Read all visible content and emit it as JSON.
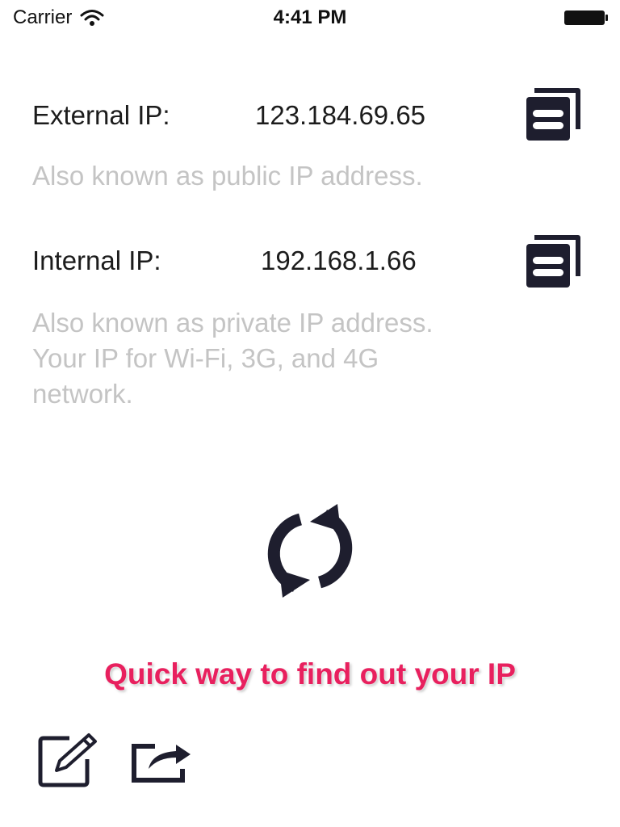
{
  "status_bar": {
    "carrier": "Carrier",
    "time": "4:41 PM",
    "wifi_icon": "wifi-icon",
    "battery_icon": "battery-icon"
  },
  "external": {
    "label": "External IP:",
    "value": "123.184.69.65",
    "description": "Also known as public IP address.",
    "copy_icon": "copy-icon"
  },
  "internal": {
    "label": "Internal IP:",
    "value": "192.168.1.66",
    "description_lines": [
      "Also known as private IP address.",
      "Your IP for Wi-Fi, 3G, and 4G",
      "network."
    ],
    "copy_icon": "copy-icon"
  },
  "refresh_icon": "refresh-icon",
  "tagline": "Quick way to find out your IP",
  "toolbar": {
    "edit_icon": "edit-icon",
    "share_icon": "share-icon"
  },
  "colors": {
    "icon": "#1e1e2e",
    "description": "#c4c4c4",
    "tagline": "#e8205e"
  }
}
